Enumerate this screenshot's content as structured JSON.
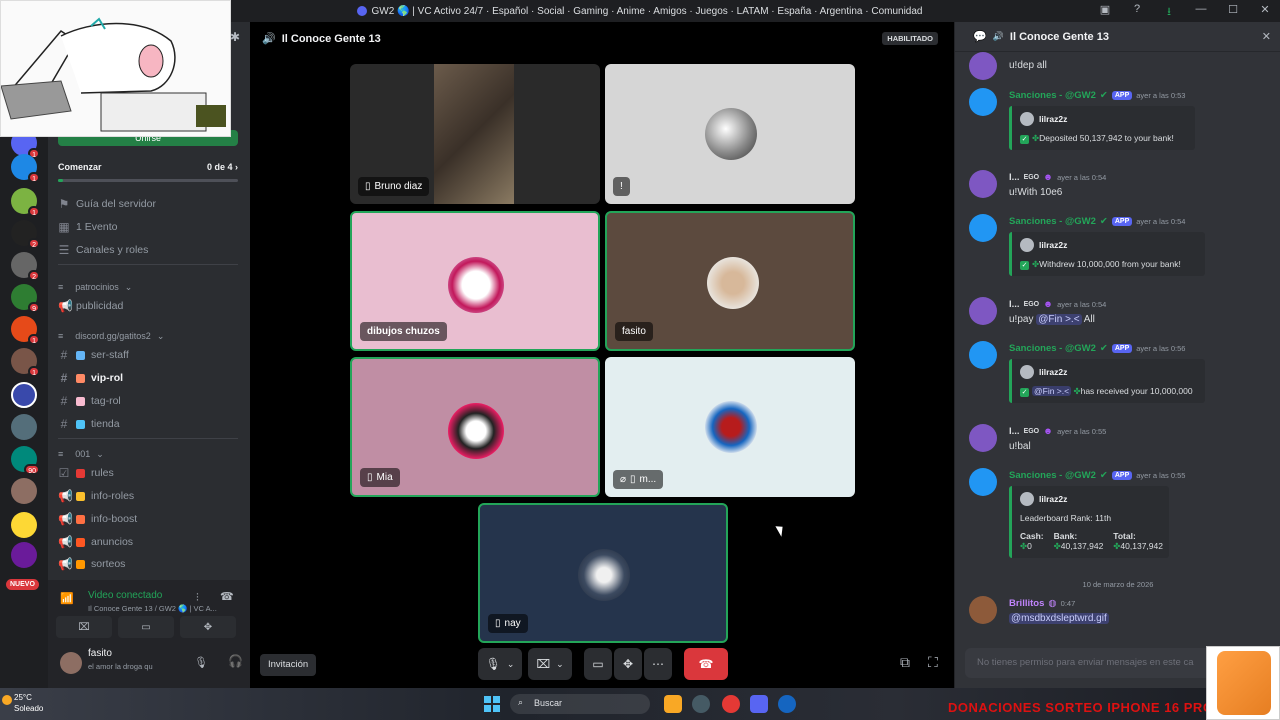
{
  "window": {
    "title": "GW2 🌎 | VC Activo 24/7 · Español · Social · Gaming · Anime · Amigos · Juegos · LATAM · España · Argentina · Comunidad"
  },
  "server_rail": {
    "badges": [
      "1",
      "1",
      "1",
      "2",
      "2",
      "9",
      "1",
      "1",
      "",
      "",
      "90",
      "",
      "",
      ""
    ],
    "nuevo_label": "NUEVO"
  },
  "sidebar": {
    "start_button": "Unirse",
    "onboarding": {
      "label": "Comenzar",
      "progress_text": "0 de 4",
      "progress": 0.03
    },
    "links": [
      "Guía del servidor",
      "1 Evento",
      "Canales y roles"
    ],
    "cat_patrocinios": "patrocinios",
    "ch_publicidad": "publicidad",
    "cat_discord": "discord.gg/gatitos2",
    "channels_a": [
      "ser-staff",
      "vip-rol",
      "tag-rol",
      "tienda"
    ],
    "cat_001": "001",
    "channels_b": [
      "rules",
      "info-roles",
      "info-boost",
      "anuncios",
      "sorteos"
    ]
  },
  "voice_panel": {
    "title": "Video conectado",
    "subtitle": "Il Conoce Gente 13 / GW2 🌎 | VC A..."
  },
  "user": {
    "name": "fasito",
    "status": "el amor la droga qu"
  },
  "voice": {
    "channel_name": "Il Conoce Gente 13",
    "badge": "HABILITADO",
    "tiles": {
      "t1": "Bruno diaz",
      "t2": "!",
      "t3": "dibujos chuzos",
      "t4": "fasito",
      "t5": "Mia",
      "t6": "m...",
      "t7": "nay"
    },
    "invite": "Invitación"
  },
  "chat": {
    "channel_name": "Il Conoce Gente 13",
    "messages": {
      "m0_text": "u!dep all",
      "bot_name": "Sanciones - @GW2",
      "app_tag": "APP",
      "embed_author": "lilraz2z",
      "m1_time": "ayer a las 0:53",
      "m1_embed": "Deposited 50,137,942 to your bank!",
      "user_name": "I...",
      "ego_tag": "EGO",
      "m2_time": "ayer a las 0:54",
      "m2_text": "u!With 10e6",
      "m3_time": "ayer a las 0:54",
      "m3_embed": "Withdrew 10,000,000 from your bank!",
      "m4_time": "ayer a las 0:54",
      "m4_cmd": "u!pay",
      "m4_mention": "@Fin >.<",
      "m4_rest": "All",
      "m5_time": "ayer a las 0:56",
      "m5_mention": "@Fin >.<",
      "m5_embed": "has received your 10,000,000",
      "m6_time": "ayer a las 0:55",
      "m6_text": "u!bal",
      "m7_time": "ayer a las 0:55",
      "m7_rank": "Leaderboard Rank: 11th",
      "cash_label": "Cash:",
      "cash_value": "0",
      "bank_label": "Bank:",
      "bank_value": "40,137,942",
      "total_label": "Total:",
      "total_value": "40,137,942",
      "date_divider": "10 de marzo de 2026",
      "m8_name": "Brillitos",
      "m8_time": "0:47",
      "m8_text": "@msdbxdsleptwrd.gif"
    },
    "input_placeholder": "No tienes permiso para enviar mensajes en este ca"
  },
  "taskbar": {
    "temp": "25°C",
    "weather": "Soleado",
    "search": "Buscar",
    "ticker": "DONACIONES SORTEO IPHONE 16 PRO"
  },
  "colors": {
    "accent": "#5865f2",
    "green": "#23a559",
    "red": "#da373c"
  }
}
